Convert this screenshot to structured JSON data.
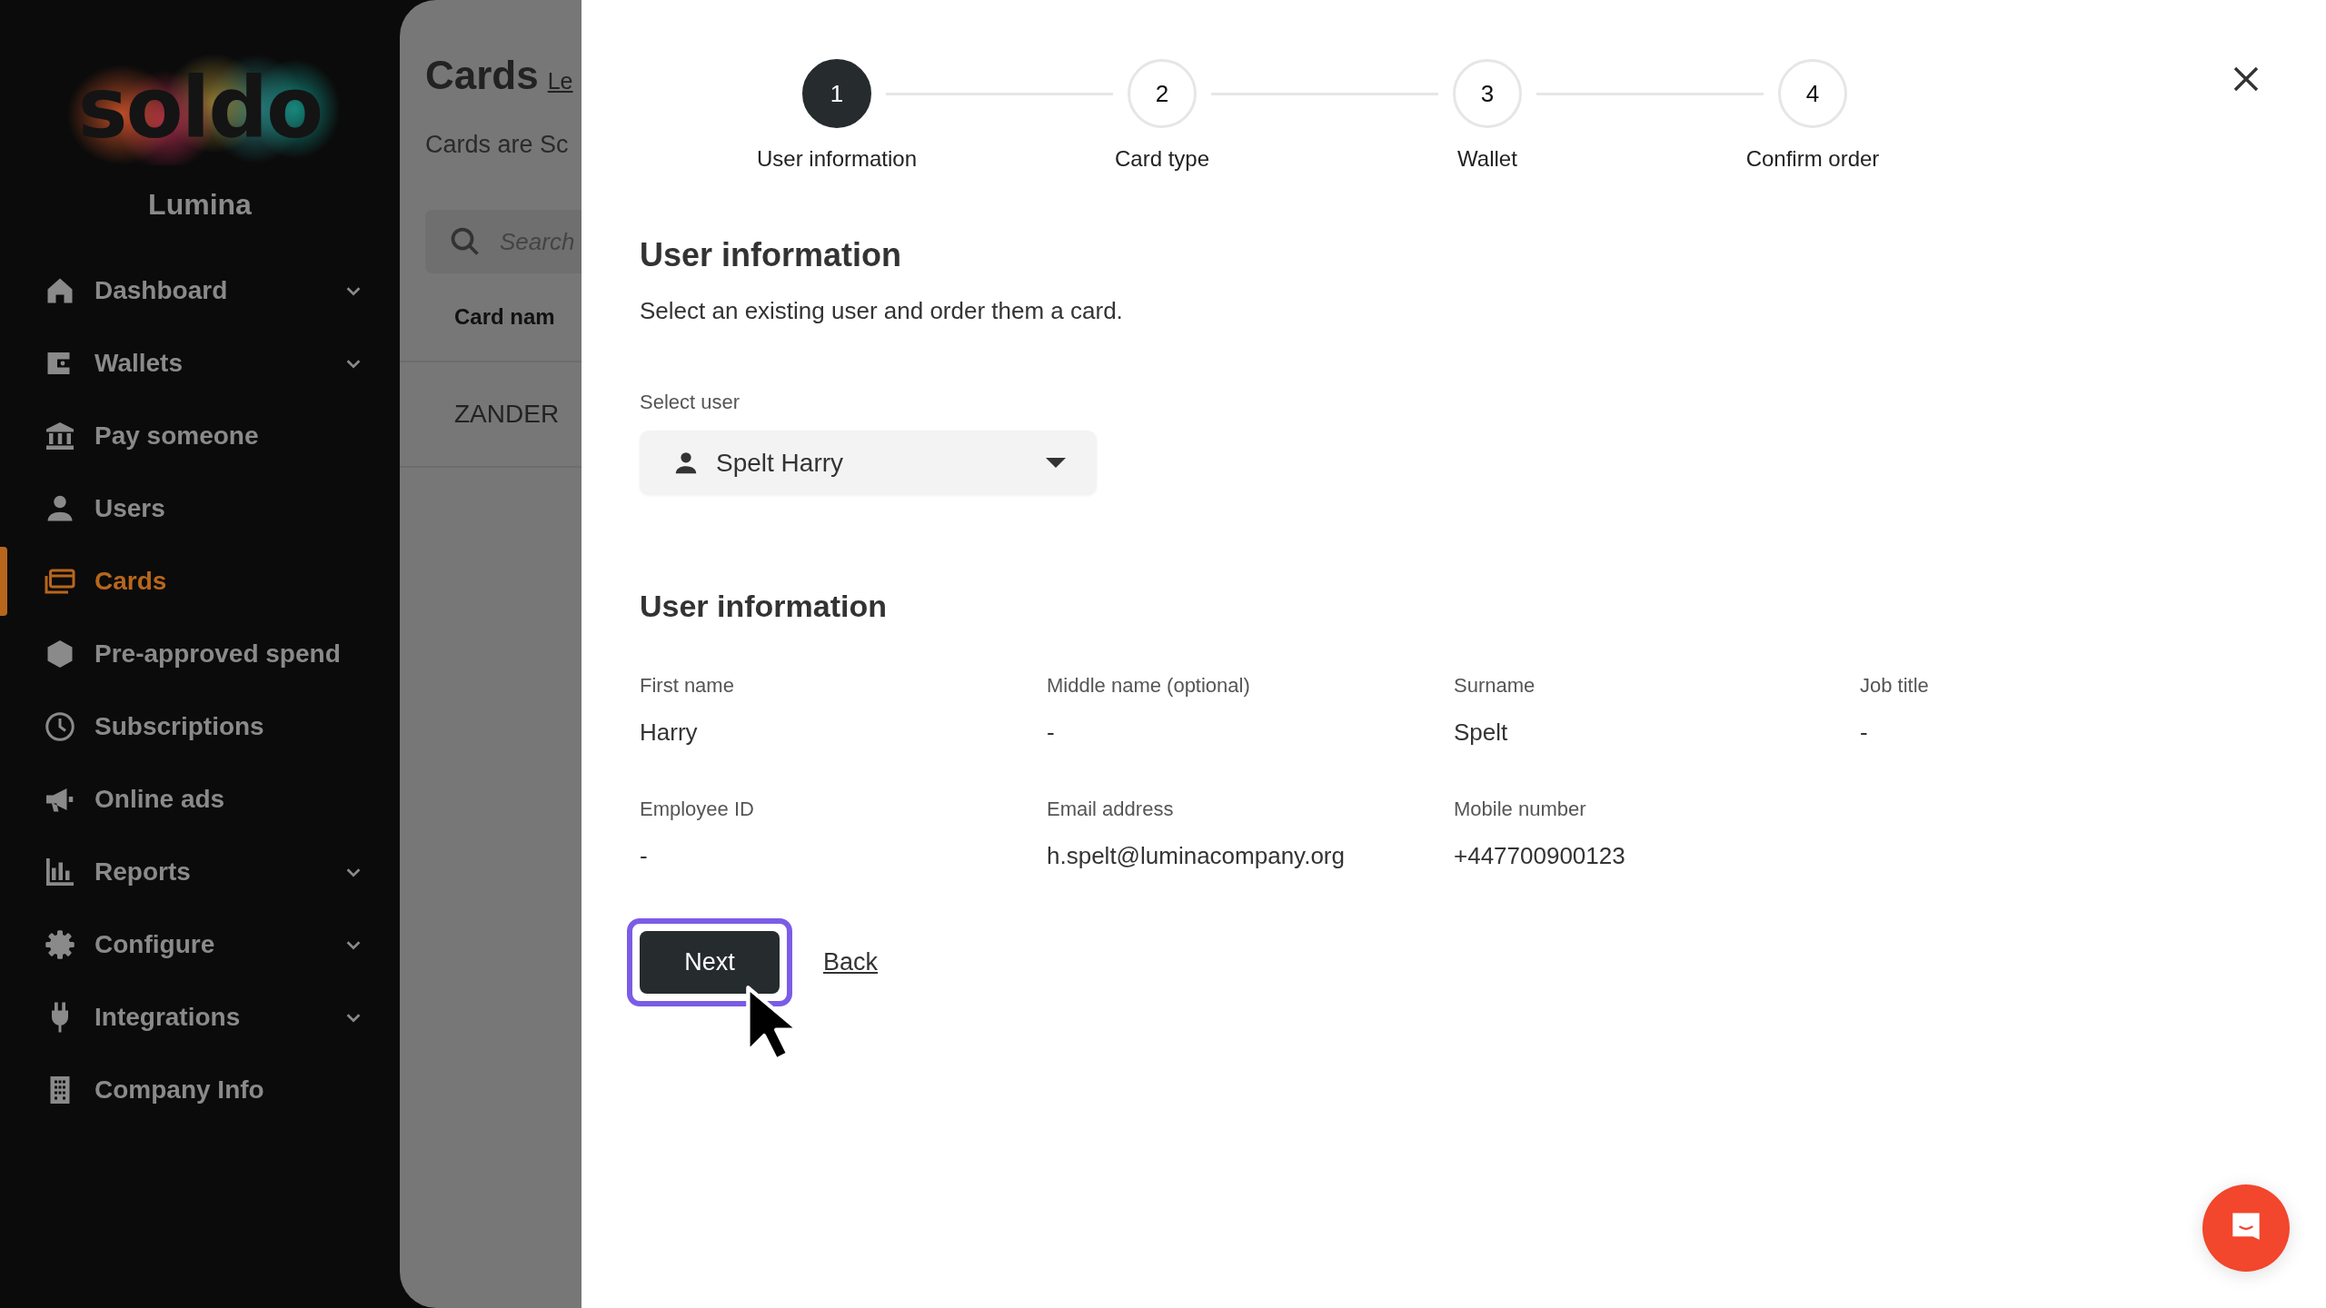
{
  "sidebar": {
    "logo": "soldo",
    "company": "Lumina",
    "items": [
      {
        "label": "Dashboard",
        "expandable": true,
        "selected": false
      },
      {
        "label": "Wallets",
        "expandable": true,
        "selected": false
      },
      {
        "label": "Pay someone",
        "expandable": false,
        "selected": false
      },
      {
        "label": "Users",
        "expandable": false,
        "selected": false
      },
      {
        "label": "Cards",
        "expandable": false,
        "selected": true
      },
      {
        "label": "Pre-approved spend",
        "expandable": false,
        "selected": false
      },
      {
        "label": "Subscriptions",
        "expandable": false,
        "selected": false
      },
      {
        "label": "Online ads",
        "expandable": false,
        "selected": false
      },
      {
        "label": "Reports",
        "expandable": true,
        "selected": false
      },
      {
        "label": "Configure",
        "expandable": true,
        "selected": false
      },
      {
        "label": "Integrations",
        "expandable": true,
        "selected": false
      },
      {
        "label": "Company Info",
        "expandable": false,
        "selected": false
      }
    ]
  },
  "background_page": {
    "title": "Cards",
    "title_link": "Le",
    "description": "Cards are Sc",
    "search": {
      "placeholder": "Search"
    },
    "table": {
      "columns": [
        "Card nam"
      ],
      "rows": [
        [
          "ZANDER"
        ]
      ]
    }
  },
  "modal": {
    "steps": [
      {
        "number": "1",
        "label": "User information",
        "selected": true
      },
      {
        "number": "2",
        "label": "Card type",
        "selected": false
      },
      {
        "number": "3",
        "label": "Wallet",
        "selected": false
      },
      {
        "number": "4",
        "label": "Confirm order",
        "selected": false
      }
    ],
    "heading": "User information",
    "subtitle": "Select an existing user and order them a card.",
    "select_user": {
      "label": "Select user",
      "value": "Spelt Harry"
    },
    "details_heading": "User information",
    "details": [
      {
        "label": "First name",
        "value": "Harry"
      },
      {
        "label": "Middle name (optional)",
        "value": "-"
      },
      {
        "label": "Surname",
        "value": "Spelt"
      },
      {
        "label": "Job title",
        "value": "-"
      },
      {
        "label": "Employee ID",
        "value": "-"
      },
      {
        "label": "Email address",
        "value": "h.spelt@luminacompany.org"
      },
      {
        "label": "Mobile number",
        "value": "+447700900123"
      }
    ],
    "actions": {
      "next": {
        "label": "Next",
        "focused": true
      },
      "back": {
        "label": "Back"
      }
    }
  }
}
